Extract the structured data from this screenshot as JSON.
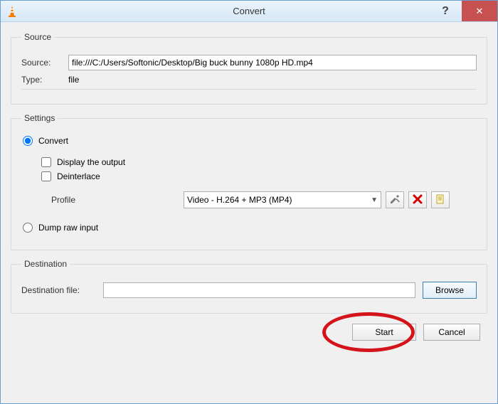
{
  "window": {
    "title": "Convert"
  },
  "source": {
    "group_label": "Source",
    "source_label": "Source:",
    "source_value": "file:///C:/Users/Softonic/Desktop/Big buck bunny 1080p HD.mp4",
    "type_label": "Type:",
    "type_value": "file"
  },
  "settings": {
    "group_label": "Settings",
    "convert_label": "Convert",
    "display_label": "Display the output",
    "deinterlace_label": "Deinterlace",
    "profile_label": "Profile",
    "profile_value": "Video - H.264 + MP3 (MP4)",
    "dump_label": "Dump raw input"
  },
  "destination": {
    "group_label": "Destination",
    "dest_label": "Destination file:",
    "dest_value": "",
    "browse_label": "Browse"
  },
  "footer": {
    "start_label": "Start",
    "cancel_label": "Cancel"
  }
}
